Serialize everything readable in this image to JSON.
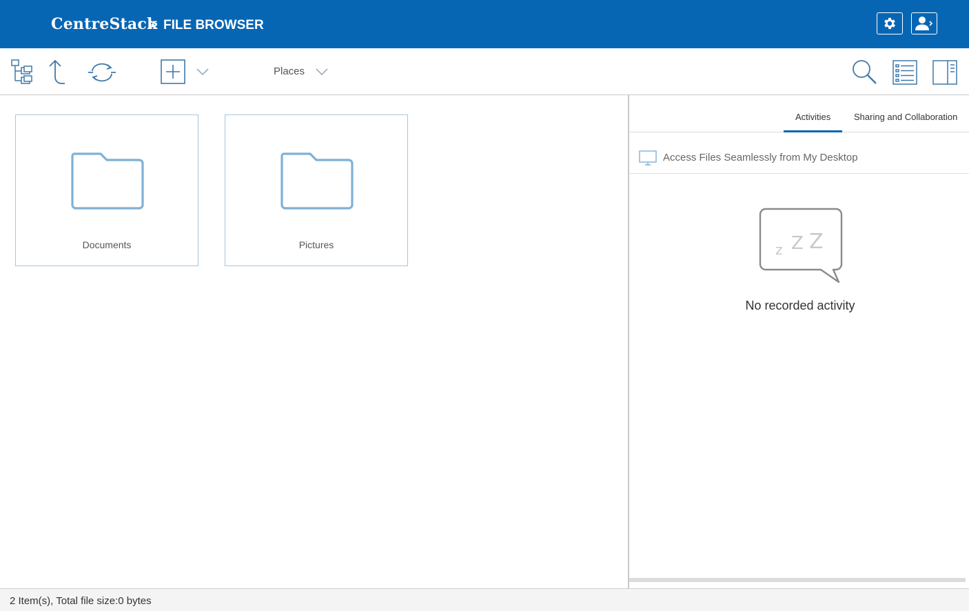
{
  "header": {
    "brand": "CentreStack",
    "separator": ">",
    "section": "FILE BROWSER",
    "settings_icon": "gear-icon",
    "user_icon": "user-account-icon"
  },
  "toolbar": {
    "icons": [
      "folder-tree-icon",
      "up-arrow-icon",
      "refresh-icon",
      "add-icon",
      "chevron-down-icon",
      "search-icon",
      "list-view-icon",
      "side-panel-icon"
    ],
    "places_label": "Places"
  },
  "files": [
    {
      "name": "Documents",
      "type": "folder"
    },
    {
      "name": "Pictures",
      "type": "folder"
    }
  ],
  "panel": {
    "tabs": [
      {
        "label": "Activities",
        "active": true
      },
      {
        "label": "Sharing and Collaboration",
        "active": false
      }
    ],
    "desktop_link": "Access Files Seamlessly from My Desktop",
    "empty_text": "No recorded activity"
  },
  "status": {
    "text": "2 Item(s), Total file size:0 bytes"
  },
  "colors": {
    "brand_blue": "#0766b4",
    "icon_blue": "#3f78a8",
    "folder_blue": "#7fb0d6"
  }
}
